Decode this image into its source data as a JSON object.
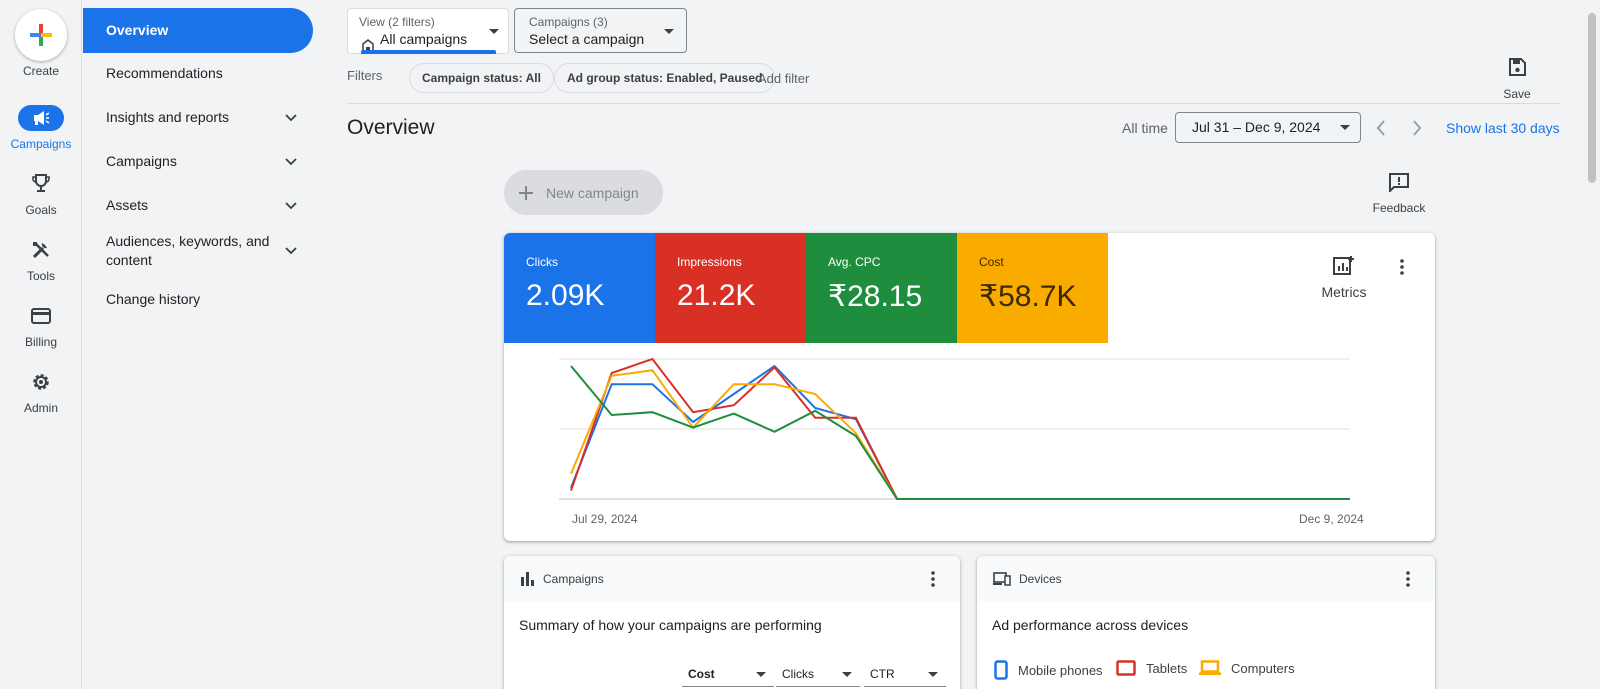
{
  "rail": {
    "create_label": "Create",
    "items": [
      {
        "label": "Campaigns",
        "icon": "megaphone-icon",
        "active": true
      },
      {
        "label": "Goals",
        "icon": "trophy-icon"
      },
      {
        "label": "Tools",
        "icon": "tools-icon"
      },
      {
        "label": "Billing",
        "icon": "credit-card-icon"
      },
      {
        "label": "Admin",
        "icon": "gear-icon"
      }
    ]
  },
  "nav": {
    "items": [
      {
        "label": "Overview",
        "active": true
      },
      {
        "label": "Recommendations"
      },
      {
        "label": "Insights and reports",
        "expandable": true
      },
      {
        "label": "Campaigns",
        "expandable": true
      },
      {
        "label": "Assets",
        "expandable": true
      },
      {
        "label": "Audiences, keywords, and content",
        "expandable": true
      },
      {
        "label": "Change history"
      }
    ]
  },
  "view_filter": {
    "small": "View (2 filters)",
    "value": "All campaigns"
  },
  "campaigns_filter": {
    "small": "Campaigns (3)",
    "value": "Select a campaign"
  },
  "filters": {
    "label": "Filters",
    "chips": [
      "Campaign status: All",
      "Ad group status: Enabled, Paused"
    ],
    "add_label": "Add filter"
  },
  "save_label": "Save",
  "page": {
    "title": "Overview",
    "all_time": "All time",
    "date_range": "Jul 31 – Dec 9, 2024",
    "show_last": "Show last 30 days"
  },
  "new_campaign_label": "New campaign",
  "feedback_label": "Feedback",
  "scorecards": [
    {
      "label": "Clicks",
      "value": "2.09K",
      "color": "#1a73e8"
    },
    {
      "label": "Impressions",
      "value": "21.2K",
      "color": "#d93025"
    },
    {
      "label": "Avg. CPC",
      "value": "₹28.15",
      "color": "#1e8e3e"
    },
    {
      "label": "Cost",
      "value": "₹58.7K",
      "color": "#f9ab00"
    }
  ],
  "metrics_label": "Metrics",
  "chart_data": {
    "type": "line",
    "x_labels": [
      "Jul 29, 2024",
      "Dec 9, 2024"
    ],
    "points_count": 20,
    "grid": true,
    "series": [
      {
        "color": "#1a73e8",
        "values": [
          0.08,
          0.82,
          0.82,
          0.55,
          0.75,
          0.95,
          0.65,
          0.57,
          0,
          0,
          0,
          0,
          0,
          0,
          0,
          0,
          0,
          0,
          0,
          0
        ]
      },
      {
        "color": "#d93025",
        "values": [
          0.06,
          0.9,
          1.0,
          0.62,
          0.67,
          0.94,
          0.58,
          0.58,
          0,
          0,
          0,
          0,
          0,
          0,
          0,
          0,
          0,
          0,
          0,
          0
        ]
      },
      {
        "color": "#f9ab00",
        "values": [
          0.18,
          0.88,
          0.92,
          0.51,
          0.82,
          0.82,
          0.75,
          0.47,
          0,
          0,
          0,
          0,
          0,
          0,
          0,
          0,
          0,
          0,
          0,
          0
        ]
      },
      {
        "color": "#1e8e3e",
        "values": [
          0.95,
          0.6,
          0.62,
          0.51,
          0.61,
          0.48,
          0.63,
          0.45,
          0,
          0,
          0,
          0,
          0,
          0,
          0,
          0,
          0,
          0,
          0,
          0
        ]
      }
    ]
  },
  "campaigns_card": {
    "title": "Campaigns",
    "subtitle": "Summary of how your campaigns are performing",
    "columns": [
      "Cost",
      "Clicks",
      "CTR"
    ]
  },
  "devices_card": {
    "title": "Devices",
    "subtitle": "Ad performance across devices",
    "legend": [
      {
        "label": "Mobile phones",
        "color": "#1a73e8"
      },
      {
        "label": "Tablets",
        "color": "#d93025"
      },
      {
        "label": "Computers",
        "color": "#f9ab00"
      }
    ]
  }
}
